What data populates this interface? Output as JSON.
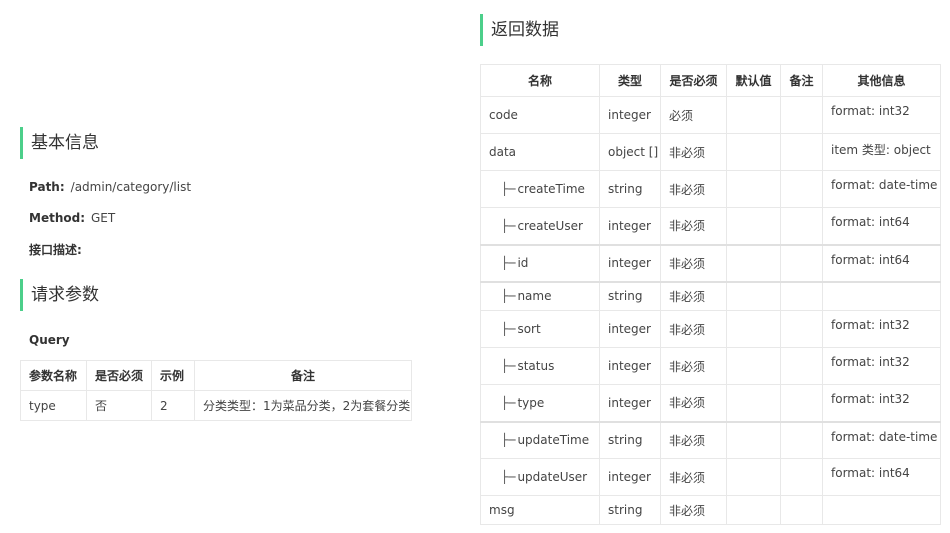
{
  "basic_info": {
    "title": "基本信息",
    "path_label": "Path:",
    "path_value": "/admin/category/list",
    "method_label": "Method:",
    "method_value": "GET",
    "desc_label": "接口描述:"
  },
  "request_params": {
    "title": "请求参数",
    "query_label": "Query",
    "headers": [
      "参数名称",
      "是否必须",
      "示例",
      "备注"
    ],
    "rows": [
      {
        "name": "type",
        "required": "否",
        "example": "2",
        "note": "分类类型：1为菜品分类，2为套餐分类"
      }
    ]
  },
  "response": {
    "title": "返回数据",
    "headers": [
      "名称",
      "类型",
      "是否必须",
      "默认值",
      "备注",
      "其他信息"
    ],
    "rows": [
      {
        "name": "code",
        "type": "integer",
        "required": "必须",
        "default": "",
        "note": "",
        "other": "format: int32"
      },
      {
        "name": "data",
        "type": "object []",
        "required": "非必须",
        "default": "",
        "note": "",
        "other": "item 类型: object"
      },
      {
        "name": "createTime",
        "type": "string",
        "required": "非必须",
        "default": "",
        "note": "",
        "other": "format: date-time"
      },
      {
        "name": "createUser",
        "type": "integer",
        "required": "非必须",
        "default": "",
        "note": "",
        "other": "format: int64"
      },
      {
        "name": "id",
        "type": "integer",
        "required": "非必须",
        "default": "",
        "note": "",
        "other": "format: int64"
      },
      {
        "name": "name",
        "type": "string",
        "required": "非必须",
        "default": "",
        "note": "",
        "other": ""
      },
      {
        "name": "sort",
        "type": "integer",
        "required": "非必须",
        "default": "",
        "note": "",
        "other": "format: int32"
      },
      {
        "name": "status",
        "type": "integer",
        "required": "非必须",
        "default": "",
        "note": "",
        "other": "format: int32"
      },
      {
        "name": "type",
        "type": "integer",
        "required": "非必须",
        "default": "",
        "note": "",
        "other": "format: int32"
      },
      {
        "name": "updateTime",
        "type": "string",
        "required": "非必须",
        "default": "",
        "note": "",
        "other": "format: date-time"
      },
      {
        "name": "updateUser",
        "type": "integer",
        "required": "非必须",
        "default": "",
        "note": "",
        "other": "format: int64"
      },
      {
        "name": "msg",
        "type": "string",
        "required": "非必须",
        "default": "",
        "note": "",
        "other": ""
      }
    ],
    "tree_prefix": "├─"
  },
  "colors": {
    "accent": "#4ccf8a",
    "border": "#e8e8e8"
  }
}
